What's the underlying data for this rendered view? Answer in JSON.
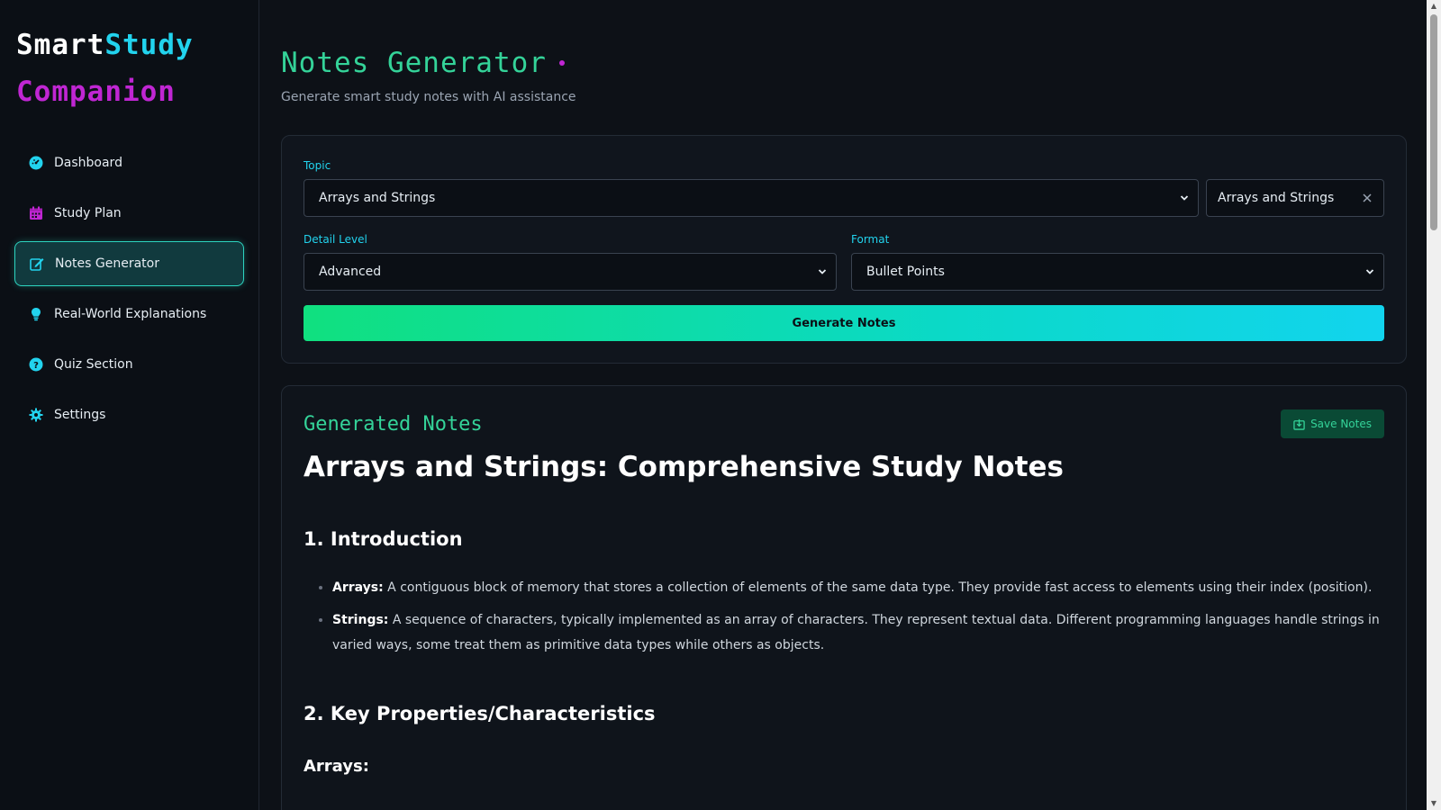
{
  "brand": {
    "part1": "Smart",
    "part2": "Study",
    "part3": "Companion"
  },
  "sidebar": {
    "items": [
      {
        "label": "Dashboard",
        "icon": "dashboard-icon",
        "active": false
      },
      {
        "label": "Study Plan",
        "icon": "calendar-icon",
        "active": false
      },
      {
        "label": "Notes Generator",
        "icon": "edit-icon",
        "active": true
      },
      {
        "label": "Real-World Explanations",
        "icon": "lightbulb-icon",
        "active": false
      },
      {
        "label": "Quiz Section",
        "icon": "question-icon",
        "active": false
      },
      {
        "label": "Settings",
        "icon": "gear-icon",
        "active": false
      }
    ]
  },
  "header": {
    "title": "Notes Generator",
    "subtitle": "Generate smart study notes with AI assistance"
  },
  "form": {
    "topic_label": "Topic",
    "topic_value": "Arrays and Strings",
    "topic_tag": "Arrays and Strings",
    "detail_label": "Detail Level",
    "detail_value": "Advanced",
    "format_label": "Format",
    "format_value": "Bullet Points",
    "generate_label": "Generate Notes"
  },
  "notes": {
    "section_label": "Generated Notes",
    "save_label": "Save Notes",
    "title": "Arrays and Strings: Comprehensive Study Notes",
    "sections": [
      {
        "heading": "1. Introduction",
        "bullets": [
          {
            "term": "Arrays:",
            "text": " A contiguous block of memory that stores a collection of elements of the same data type. They provide fast access to elements using their index (position)."
          },
          {
            "term": "Strings:",
            "text": " A sequence of characters, typically implemented as an array of characters. They represent textual data. Different programming languages handle strings in varied ways, some treat them as primitive data types while others as objects."
          }
        ]
      },
      {
        "heading": "2. Key Properties/Characteristics",
        "subheading": "Arrays:"
      }
    ]
  },
  "colors": {
    "accent_green": "#34d399",
    "accent_cyan": "#22d3ee",
    "accent_magenta": "#c026d3",
    "background": "#0d1117"
  }
}
